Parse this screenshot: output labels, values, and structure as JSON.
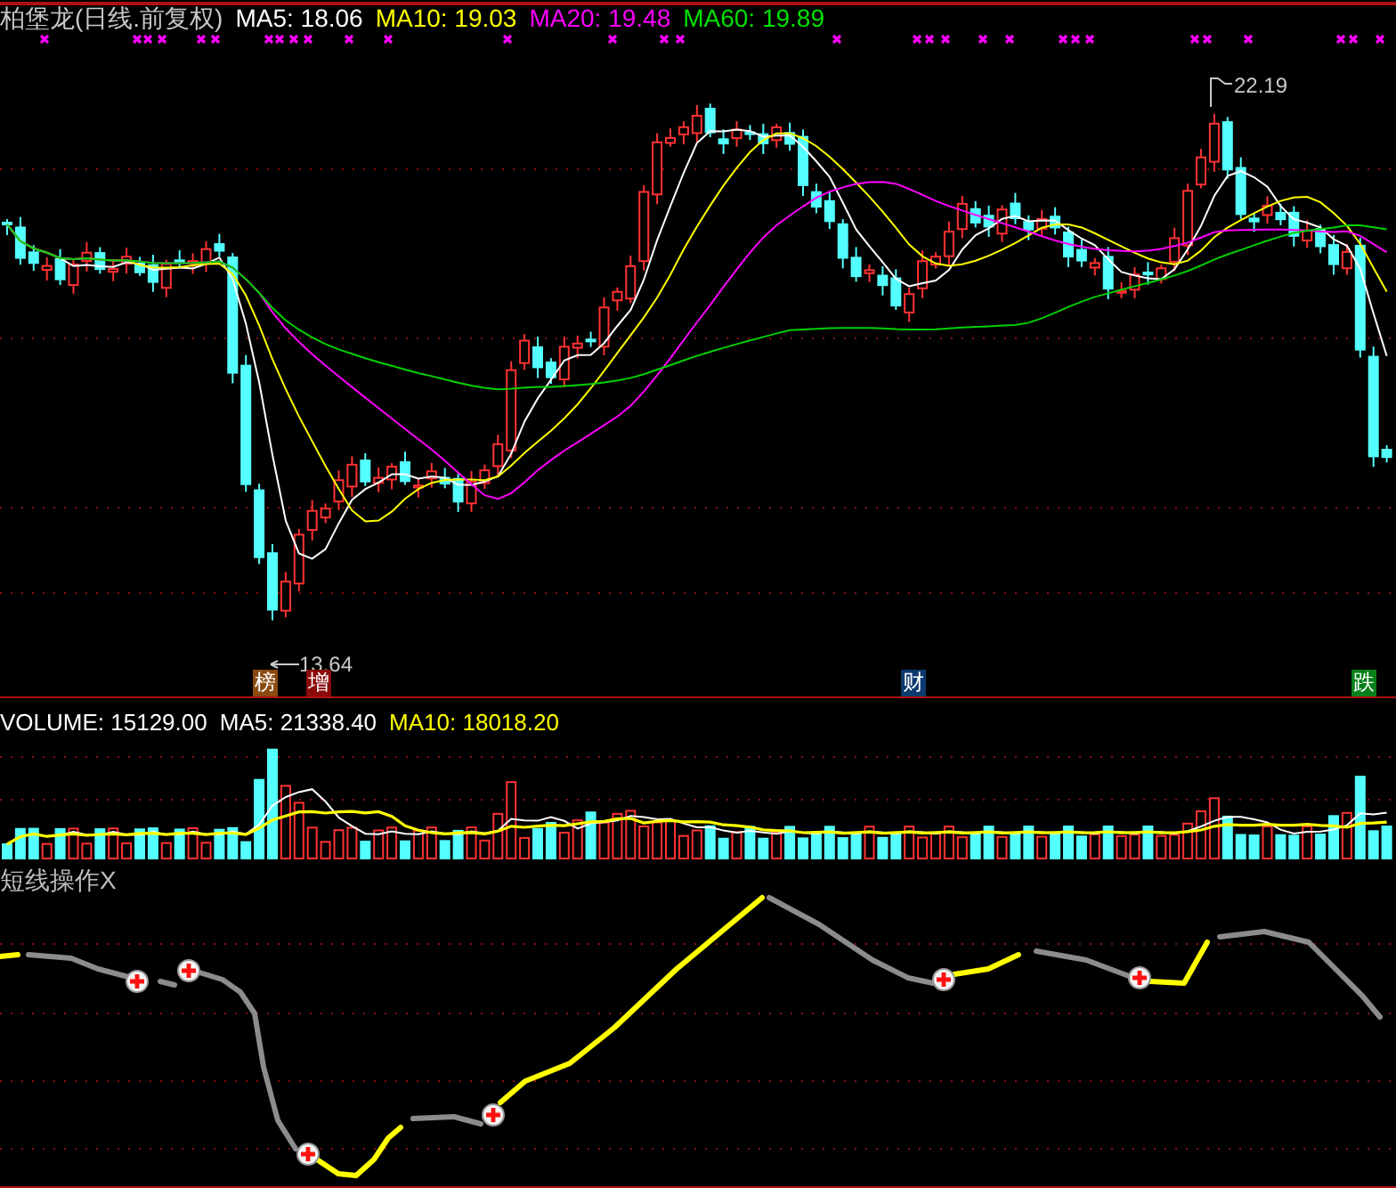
{
  "price_pane": {
    "title": "柏堡龙(日线.前复权)",
    "legend": [
      {
        "label": "MA5: 18.06",
        "color": "#ffffff"
      },
      {
        "label": "MA10: 19.03",
        "color": "#ffff00"
      },
      {
        "label": "MA20: 19.48",
        "color": "#ff00ff"
      },
      {
        "label": "MA60: 19.89",
        "color": "#00e000"
      }
    ],
    "high_label": "22.19",
    "low_label": "13.64",
    "markers": [
      {
        "label": "榜",
        "color": "#8b4a10"
      },
      {
        "label": "增",
        "color": "#8b0a0a"
      },
      {
        "label": "财",
        "color": "#0b3a6e"
      },
      {
        "label": "跌",
        "color": "#08801a"
      }
    ]
  },
  "volume_pane": {
    "legend": [
      {
        "label": "VOLUME: 15129.00",
        "color": "#ffffff"
      },
      {
        "label": "MA5: 21338.40",
        "color": "#ffffff"
      },
      {
        "label": "MA10: 18018.20",
        "color": "#ffff00"
      }
    ]
  },
  "indicator_pane": {
    "title": "短线操作X"
  }
}
